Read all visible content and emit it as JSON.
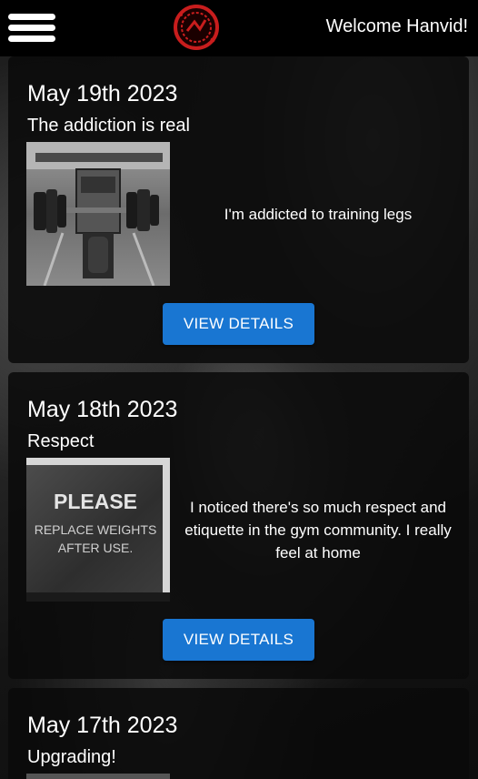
{
  "header": {
    "menu_icon": "hamburger-menu-icon",
    "logo_icon": "red-stamp-logo",
    "welcome_text": "Welcome Hanvid!"
  },
  "posts": [
    {
      "date": "May 19th 2023",
      "title": "The addiction is real",
      "photo": "leg-press-machine-photo",
      "text": "I'm addicted to training legs",
      "button_label": "VIEW DETAILS"
    },
    {
      "date": "May 18th 2023",
      "title": "Respect",
      "photo": "replace-weights-sign-photo",
      "sign_heading": "PLEASE",
      "sign_body": "REPLACE WEIGHTS AFTER USE.",
      "text": "I noticed there's so much respect and etiquette in the gym community. I really feel at home",
      "button_label": "VIEW DETAILS"
    },
    {
      "date": "May 17th 2023",
      "title": "Upgrading!"
    }
  ],
  "colors": {
    "header_bg": "#000000",
    "card_bg": "#0a0a0a",
    "button_bg": "#1976d2",
    "logo_red": "#c81d1d"
  }
}
